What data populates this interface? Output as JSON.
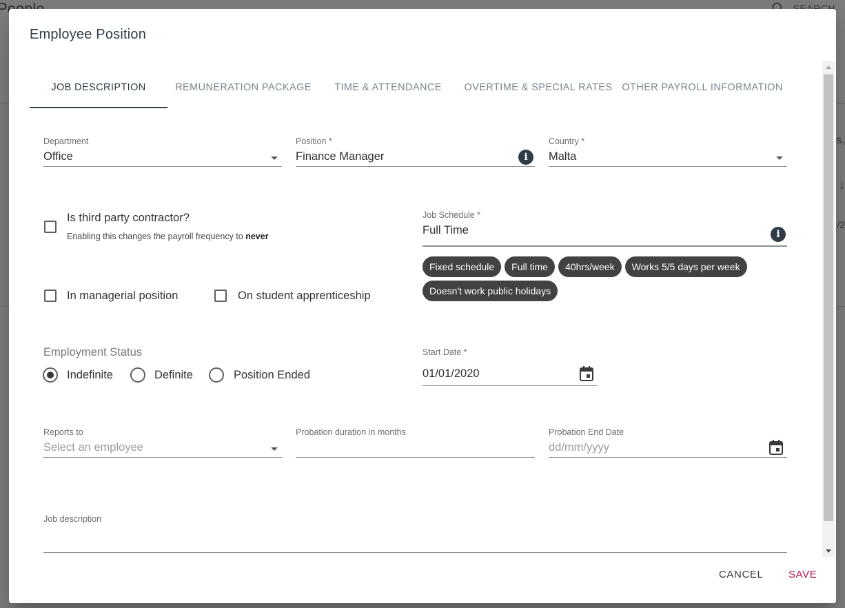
{
  "background": {
    "title": "People",
    "search_label": "SEARCH",
    "fragment_1": "rs,",
    "fragment_2": "↓",
    "fragment_3": "/2"
  },
  "dialog": {
    "title": "Employee Position",
    "tabs": [
      {
        "label": "JOB DESCRIPTION",
        "active": true
      },
      {
        "label": "REMUNERATION PACKAGE",
        "active": false
      },
      {
        "label": "TIME & ATTENDANCE",
        "active": false
      },
      {
        "label": "OVERTIME & SPECIAL RATES",
        "active": false
      },
      {
        "label": "OTHER PAYROLL INFORMATION",
        "active": false
      }
    ],
    "department": {
      "label": "Department",
      "value": "Office"
    },
    "position": {
      "label": "Position *",
      "value": "Finance Manager"
    },
    "country": {
      "label": "Country *",
      "value": "Malta"
    },
    "third_party": {
      "label": "Is third party contractor?",
      "hint_prefix": "Enabling this changes the payroll frequency to ",
      "hint_bold": "never",
      "checked": false
    },
    "job_schedule": {
      "label": "Job Schedule *",
      "value": "Full Time",
      "chips": [
        "Fixed schedule",
        "Full time",
        "40hrs/week",
        "Works 5/5 days per week",
        "Doesn't work public holidays"
      ]
    },
    "managerial": {
      "label": "In managerial position",
      "checked": false
    },
    "apprenticeship": {
      "label": "On student apprenticeship",
      "checked": false
    },
    "employment_status": {
      "label": "Employment Status",
      "options": [
        {
          "label": "Indefinite",
          "checked": true
        },
        {
          "label": "Definite",
          "checked": false
        },
        {
          "label": "Position Ended",
          "checked": false
        }
      ]
    },
    "start_date": {
      "label": "Start Date *",
      "value": "01/01/2020"
    },
    "reports_to": {
      "label": "Reports to",
      "placeholder": "Select an employee"
    },
    "probation_duration": {
      "label": "Probation duration in months",
      "value": ""
    },
    "probation_end": {
      "label": "Probation End Date",
      "placeholder": "dd/mm/yyyy"
    },
    "job_description": {
      "label": "Job description",
      "value": ""
    },
    "actions": {
      "cancel": "CANCEL",
      "save": "SAVE"
    },
    "colors": {
      "primary": "#2f3b45",
      "accent": "#b5144a",
      "chip": "#424242"
    }
  }
}
